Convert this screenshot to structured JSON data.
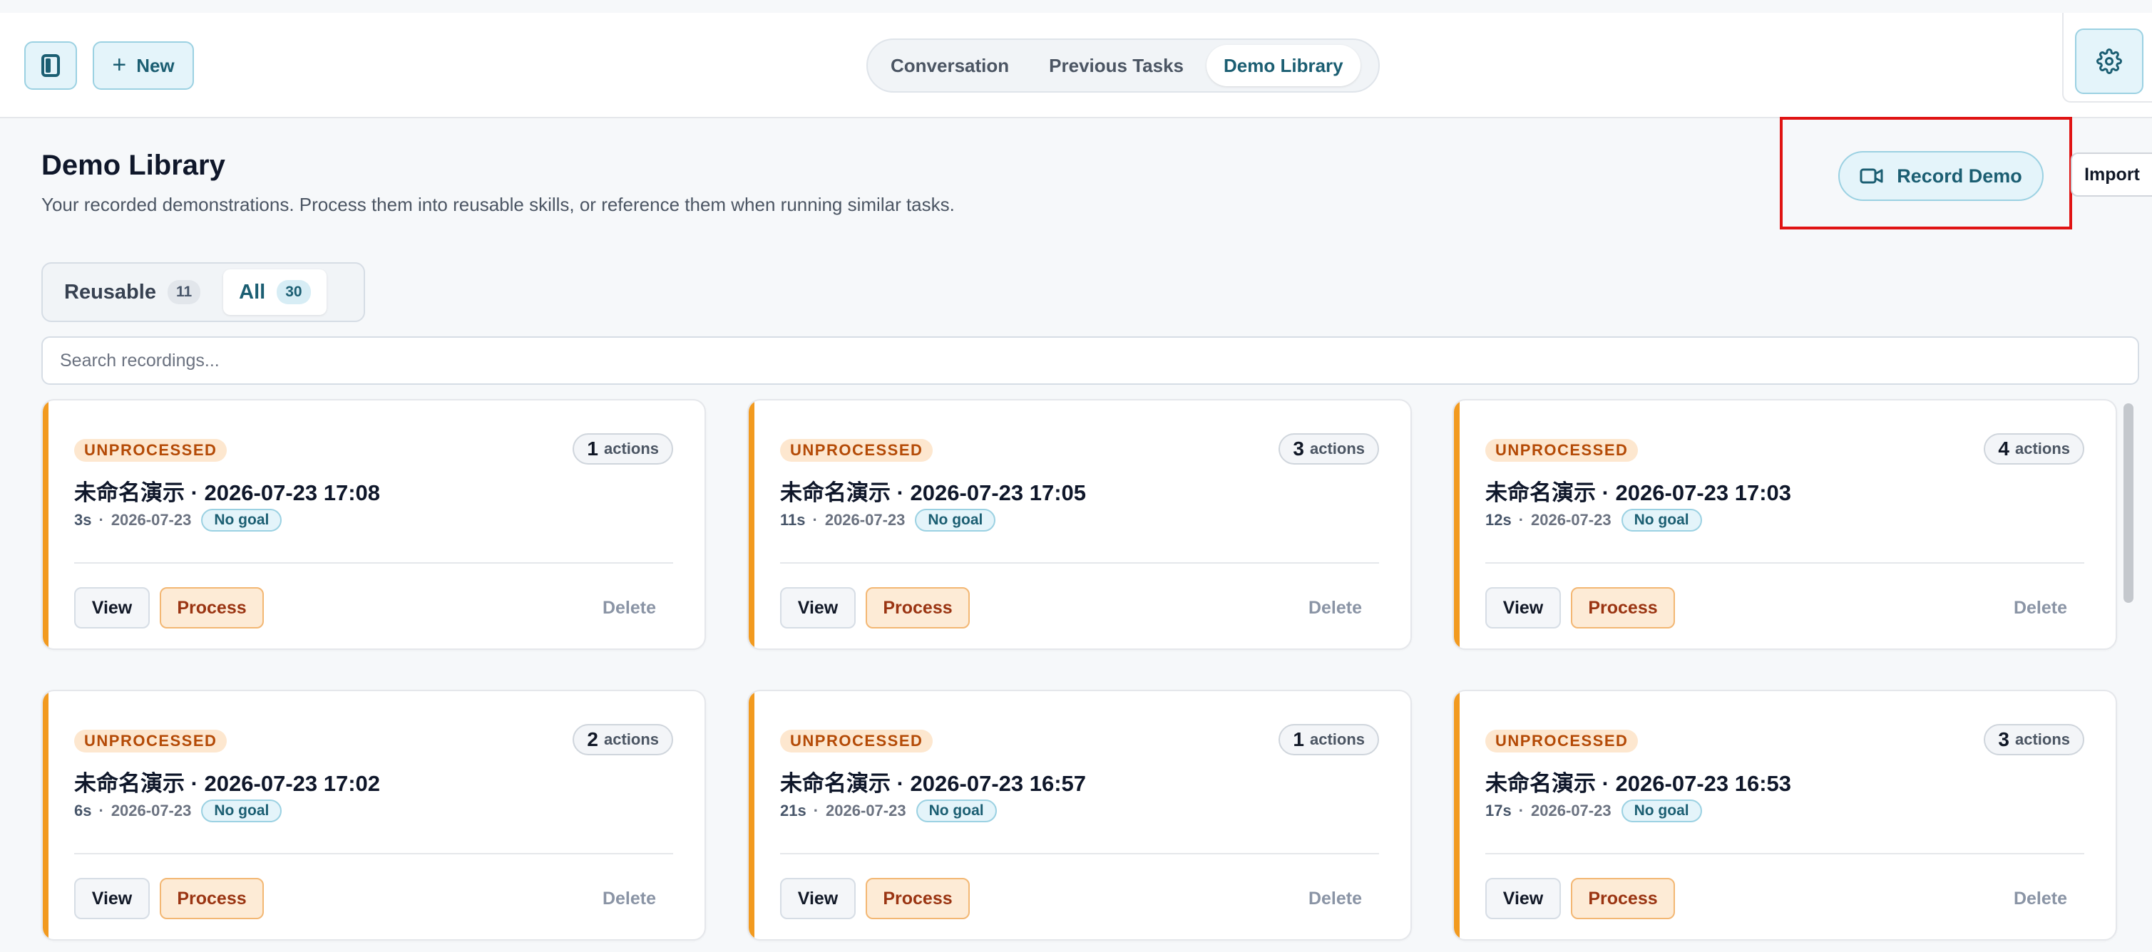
{
  "topbar": {
    "new_label": "New",
    "tabs": [
      "Conversation",
      "Previous Tasks",
      "Demo Library"
    ],
    "active_tab": "Demo Library"
  },
  "header": {
    "title": "Demo Library",
    "subtitle": "Your recorded demonstrations. Process them into reusable skills, or reference them when running similar tasks.",
    "record_label": "Record Demo",
    "import_label": "Import"
  },
  "filters": [
    {
      "label": "Reusable",
      "count": "11"
    },
    {
      "label": "All",
      "count": "30"
    }
  ],
  "active_filter": "All",
  "search": {
    "placeholder": "Search recordings..."
  },
  "card_labels": {
    "status": "UNPROCESSED",
    "actions_suffix": "actions",
    "goal": "No goal",
    "view": "View",
    "process": "Process",
    "delete": "Delete"
  },
  "cards": [
    {
      "title": "未命名演示 · 2026-07-23 17:08",
      "duration": "3s",
      "date": "2026-07-23",
      "actions": "1"
    },
    {
      "title": "未命名演示 · 2026-07-23 17:05",
      "duration": "11s",
      "date": "2026-07-23",
      "actions": "3"
    },
    {
      "title": "未命名演示 · 2026-07-23 17:03",
      "duration": "12s",
      "date": "2026-07-23",
      "actions": "4"
    },
    {
      "title": "未命名演示 · 2026-07-23 17:02",
      "duration": "6s",
      "date": "2026-07-23",
      "actions": "2"
    },
    {
      "title": "未命名演示 · 2026-07-23 16:57",
      "duration": "21s",
      "date": "2026-07-23",
      "actions": "1"
    },
    {
      "title": "未命名演示 · 2026-07-23 16:53",
      "duration": "17s",
      "date": "2026-07-23",
      "actions": "3"
    }
  ],
  "colors": {
    "accent": "#1b5e72",
    "accent_bg": "#e4f4fa",
    "warning": "#f29a1f",
    "highlight": "#e01313"
  },
  "icons": {
    "sidebar_toggle": "sidebar-toggle-icon",
    "new": "plus-icon",
    "settings": "gear-icon",
    "record": "video-camera-icon"
  }
}
